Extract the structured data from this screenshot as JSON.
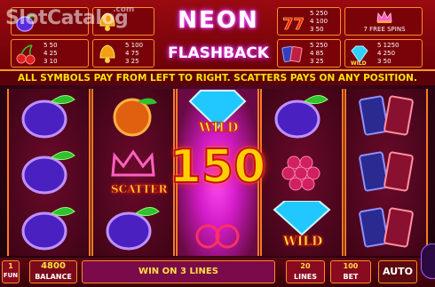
{
  "watermark": {
    "text": "SlotCatalog",
    "suffix": ".com"
  },
  "paytable": {
    "plum": [
      "5 50",
      "4 25",
      "3 10"
    ],
    "bell": [
      "5 100",
      "4 75",
      "3 25"
    ],
    "sevens": [
      "5 250",
      "4 100",
      "3 50"
    ],
    "cards": [
      "5 250",
      "4 85",
      "3 25"
    ],
    "wild": [
      "5 1250",
      "4 250",
      "3 50"
    ],
    "scatter_label": "7 FREE SPINS"
  },
  "logo": {
    "line1": "NEON",
    "line2": "FLASHBACK"
  },
  "rules": "ALL SYMBOLS PAY FROM LEFT TO RIGHT. SCATTERS PAYS ON ANY POSITION.",
  "win_amount": "150",
  "symbols": {
    "wild": "WILD",
    "scatter": "SCATTER"
  },
  "bottom": {
    "fun_value": "1",
    "fun_label": "FUN",
    "balance_value": "4800",
    "balance_label": "BALANCE",
    "message": "WIN ON 3 LINES",
    "lines_value": "20",
    "lines_label": "LINES",
    "bet_value": "100",
    "bet_label": "BET",
    "auto_label": "AUTO"
  },
  "colors": {
    "accent": "#ff8a28",
    "win": "#ffd000",
    "neon": "#ff3cff"
  }
}
